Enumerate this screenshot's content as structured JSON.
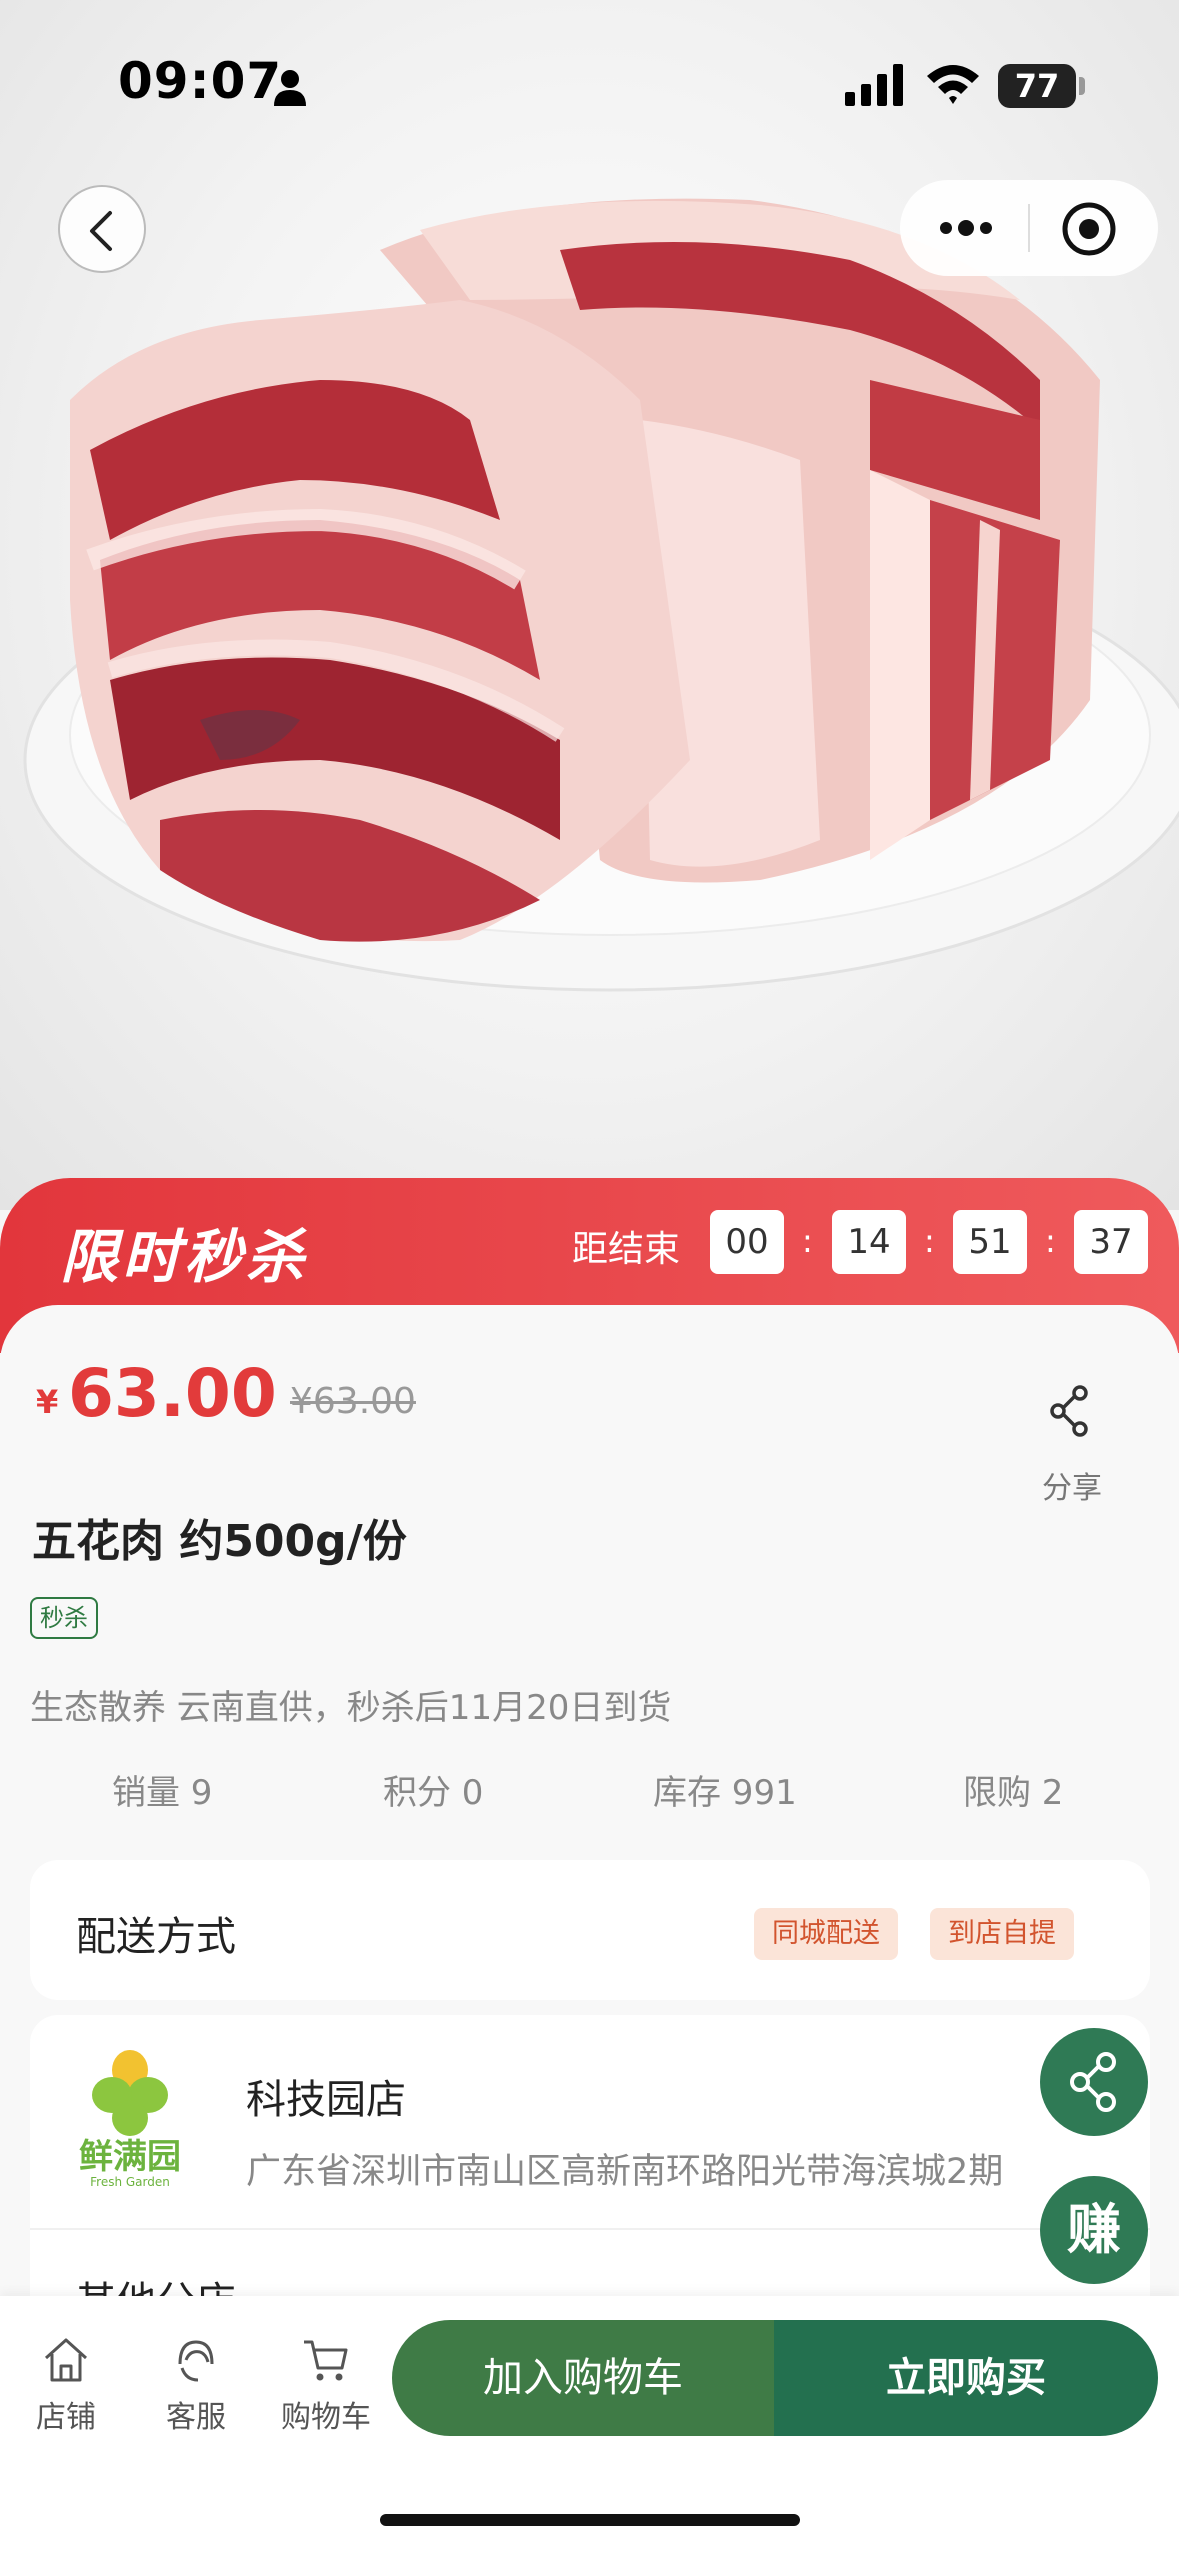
{
  "status_bar": {
    "time": "09:07",
    "battery": "77"
  },
  "flash_sale": {
    "title": "限时秒杀",
    "end_label": "距结束",
    "countdown": [
      "00",
      "14",
      "51",
      "37"
    ],
    "separator": ":"
  },
  "product": {
    "currency": "¥",
    "price": "63.00",
    "original_price": "¥63.00",
    "share_label": "分享",
    "name": "五花肉 约500g/份",
    "tag": "秒杀",
    "description": "生态散养 云南直供，秒杀后11月20日到货",
    "stats": [
      "销量 9",
      "积分 0",
      "库存 991",
      "限购 2"
    ]
  },
  "delivery": {
    "label": "配送方式",
    "options": [
      "同城配送",
      "到店自提"
    ]
  },
  "store": {
    "logo_text": "鲜满园",
    "logo_sub": "Fresh Garden",
    "name": "科技园店",
    "address": "广东省深圳市南山区高新南环路阳光带海滨城2期",
    "other_label": "其他分店"
  },
  "fab": {
    "earn_label": "赚"
  },
  "bottom_bar": {
    "nav": [
      "店铺",
      "客服",
      "购物车"
    ],
    "add_to_cart": "加入购物车",
    "buy_now": "立即购买"
  },
  "colors": {
    "flash_red": "#e2363c",
    "price_red": "#e23b3b",
    "brand_green": "#23704f",
    "cart_green": "#3f7b46"
  }
}
